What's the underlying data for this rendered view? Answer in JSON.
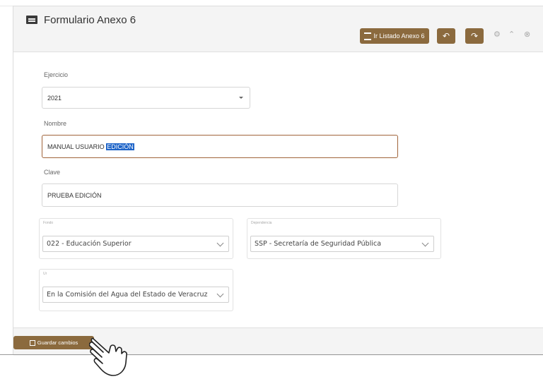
{
  "header": {
    "title": "Formulario Anexo 6",
    "list_button": "Ir Listado Anexo 6",
    "undo_icon": "undo-icon",
    "redo_icon": "redo-icon",
    "tools": [
      "⚙",
      "⌃",
      "⊗"
    ]
  },
  "form": {
    "ejercicio": {
      "label": "Ejercicio",
      "value": "2021"
    },
    "nombre": {
      "label": "Nombre",
      "value_prefix": "MANUAL USUARIO ",
      "value_selected": "EDICIÓN"
    },
    "clave": {
      "label": "Clave",
      "value": "PRUEBA EDICIÓN"
    },
    "fondo": {
      "label": "Fondo",
      "value": "022 - Educación Superior"
    },
    "dependencia": {
      "label": "Dependencia",
      "value": "SSP - Secretaría de Seguridad Pública"
    },
    "ur": {
      "label": "Ur",
      "value": "En la Comisión del Agua del Estado de Veracruz"
    }
  },
  "footer": {
    "save_button": "Guardar cambios"
  },
  "colors": {
    "accent": "#8b6a3e",
    "active_border": "#a0643a",
    "selection": "#1e64c8"
  }
}
